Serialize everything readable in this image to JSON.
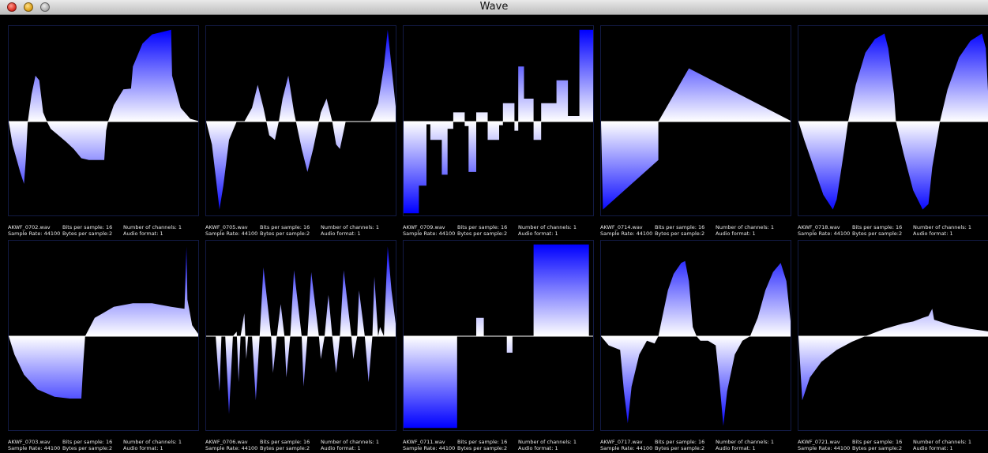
{
  "window": {
    "title": "Wave"
  },
  "colors": {
    "wave_fill_edge": "#0000ff",
    "wave_fill_center": "#ffffff",
    "background": "#000000",
    "frame": "#121a44"
  },
  "labels": {
    "bits_per_sample": "Bits per sample: 16",
    "bytes_per_sample": "Bytes per sample:2",
    "channels": "Number of channels: 1",
    "audio_format": "Audio format: 1"
  },
  "panels": [
    {
      "file": "AKWF_0702.wav",
      "sample_rate": "Sample Rate: 44100",
      "samples": [
        [
          0,
          0
        ],
        [
          0.02,
          -0.25
        ],
        [
          0.06,
          -0.55
        ],
        [
          0.08,
          -0.68
        ],
        [
          0.09,
          -0.4
        ],
        [
          0.1,
          0
        ],
        [
          0.12,
          0.3
        ],
        [
          0.14,
          0.5
        ],
        [
          0.16,
          0.45
        ],
        [
          0.18,
          0.1
        ],
        [
          0.2,
          0
        ],
        [
          0.22,
          -0.08
        ],
        [
          0.26,
          -0.15
        ],
        [
          0.3,
          -0.22
        ],
        [
          0.34,
          -0.3
        ],
        [
          0.38,
          -0.4
        ],
        [
          0.42,
          -0.42
        ],
        [
          0.48,
          -0.42
        ],
        [
          0.5,
          -0.42
        ],
        [
          0.51,
          -0.1
        ],
        [
          0.52,
          0
        ],
        [
          0.55,
          0.18
        ],
        [
          0.6,
          0.35
        ],
        [
          0.64,
          0.36
        ],
        [
          0.65,
          0.6
        ],
        [
          0.7,
          0.85
        ],
        [
          0.75,
          0.95
        ],
        [
          0.85,
          1
        ],
        [
          0.855,
          0.5
        ],
        [
          0.9,
          0.15
        ],
        [
          0.95,
          0.03
        ],
        [
          1,
          0
        ]
      ]
    },
    {
      "file": "AKWF_0705.wav",
      "sample_rate": "Sample Rate: 44100",
      "samples": [
        [
          0,
          0
        ],
        [
          0.03,
          -0.25
        ],
        [
          0.05,
          -0.6
        ],
        [
          0.07,
          -0.96
        ],
        [
          0.09,
          -0.7
        ],
        [
          0.12,
          -0.2
        ],
        [
          0.16,
          0
        ],
        [
          0.2,
          0
        ],
        [
          0.24,
          0.15
        ],
        [
          0.27,
          0.4
        ],
        [
          0.3,
          0.15
        ],
        [
          0.33,
          -0.15
        ],
        [
          0.36,
          -0.2
        ],
        [
          0.38,
          0
        ],
        [
          0.4,
          0.25
        ],
        [
          0.43,
          0.5
        ],
        [
          0.46,
          0.1
        ],
        [
          0.5,
          -0.3
        ],
        [
          0.53,
          -0.55
        ],
        [
          0.56,
          -0.3
        ],
        [
          0.6,
          0.1
        ],
        [
          0.63,
          0.25
        ],
        [
          0.66,
          0
        ],
        [
          0.68,
          -0.25
        ],
        [
          0.7,
          -0.3
        ],
        [
          0.73,
          0
        ],
        [
          0.76,
          0
        ],
        [
          0.8,
          0
        ],
        [
          0.84,
          0
        ],
        [
          0.86,
          0
        ],
        [
          0.9,
          0.2
        ],
        [
          0.93,
          0.6
        ],
        [
          0.95,
          1
        ],
        [
          0.97,
          0.6
        ],
        [
          1,
          0
        ]
      ]
    },
    {
      "file": "AKWF_0709.wav",
      "sample_rate": "Sample Rate: 44100",
      "samples": [
        [
          0,
          -1
        ],
        [
          0.08,
          -1
        ],
        [
          0.08,
          -0.7
        ],
        [
          0.12,
          -0.7
        ],
        [
          0.12,
          -0.03
        ],
        [
          0.14,
          -0.03
        ],
        [
          0.14,
          -0.2
        ],
        [
          0.2,
          -0.2
        ],
        [
          0.2,
          -0.58
        ],
        [
          0.23,
          -0.58
        ],
        [
          0.23,
          -0.08
        ],
        [
          0.26,
          -0.08
        ],
        [
          0.26,
          0.1
        ],
        [
          0.32,
          0.1
        ],
        [
          0.32,
          -0.05
        ],
        [
          0.34,
          -0.05
        ],
        [
          0.34,
          -0.55
        ],
        [
          0.38,
          -0.55
        ],
        [
          0.38,
          0.1
        ],
        [
          0.44,
          0.1
        ],
        [
          0.44,
          -0.2
        ],
        [
          0.5,
          -0.2
        ],
        [
          0.5,
          -0.04
        ],
        [
          0.52,
          -0.04
        ],
        [
          0.52,
          0.2
        ],
        [
          0.58,
          0.2
        ],
        [
          0.58,
          -0.1
        ],
        [
          0.6,
          -0.1
        ],
        [
          0.6,
          0.6
        ],
        [
          0.63,
          0.6
        ],
        [
          0.63,
          0.25
        ],
        [
          0.68,
          0.25
        ],
        [
          0.68,
          -0.2
        ],
        [
          0.72,
          -0.2
        ],
        [
          0.72,
          0.2
        ],
        [
          0.8,
          0.2
        ],
        [
          0.8,
          0.45
        ],
        [
          0.86,
          0.45
        ],
        [
          0.86,
          0.06
        ],
        [
          0.92,
          0.06
        ],
        [
          0.92,
          1
        ],
        [
          1,
          1
        ]
      ]
    },
    {
      "file": "AKWF_0714.wav",
      "sample_rate": "Sample Rate: 44100",
      "samples": [
        [
          0,
          0
        ],
        [
          0.01,
          -0.96
        ],
        [
          0.3,
          -0.42
        ],
        [
          0.3,
          0
        ],
        [
          0.46,
          0.58
        ],
        [
          1,
          0
        ]
      ]
    },
    {
      "file": "AKWF_0718.wav",
      "sample_rate": "Sample Rate: 44100",
      "samples": [
        [
          0,
          0
        ],
        [
          0.03,
          -0.2
        ],
        [
          0.08,
          -0.5
        ],
        [
          0.13,
          -0.8
        ],
        [
          0.18,
          -0.96
        ],
        [
          0.2,
          -0.85
        ],
        [
          0.24,
          -0.3
        ],
        [
          0.26,
          0
        ],
        [
          0.3,
          0.4
        ],
        [
          0.35,
          0.75
        ],
        [
          0.4,
          0.9
        ],
        [
          0.45,
          0.96
        ],
        [
          0.47,
          0.8
        ],
        [
          0.5,
          0.3
        ],
        [
          0.51,
          0
        ],
        [
          0.55,
          -0.35
        ],
        [
          0.6,
          -0.75
        ],
        [
          0.65,
          -0.96
        ],
        [
          0.68,
          -0.9
        ],
        [
          0.7,
          -0.5
        ],
        [
          0.74,
          0
        ],
        [
          0.78,
          0.35
        ],
        [
          0.84,
          0.7
        ],
        [
          0.9,
          0.88
        ],
        [
          0.96,
          0.96
        ],
        [
          0.98,
          0.8
        ],
        [
          1,
          0
        ]
      ]
    },
    {
      "file": "AKWF_0703.wav",
      "sample_rate": "Sample Rate: 44100",
      "samples": [
        [
          0,
          0
        ],
        [
          0.03,
          -0.2
        ],
        [
          0.08,
          -0.42
        ],
        [
          0.15,
          -0.58
        ],
        [
          0.24,
          -0.66
        ],
        [
          0.32,
          -0.68
        ],
        [
          0.38,
          -0.68
        ],
        [
          0.39,
          -0.3
        ],
        [
          0.4,
          0
        ],
        [
          0.45,
          0.2
        ],
        [
          0.55,
          0.32
        ],
        [
          0.65,
          0.36
        ],
        [
          0.75,
          0.36
        ],
        [
          0.85,
          0.32
        ],
        [
          0.92,
          0.3
        ],
        [
          0.93,
          0.98
        ],
        [
          0.935,
          0.4
        ],
        [
          0.96,
          0.12
        ],
        [
          1,
          0
        ]
      ]
    },
    {
      "file": "AKWF_0706.wav",
      "sample_rate": "Sample Rate: 44100",
      "samples": [
        [
          0,
          0
        ],
        [
          0.05,
          0
        ],
        [
          0.07,
          -0.6
        ],
        [
          0.08,
          0
        ],
        [
          0.1,
          0
        ],
        [
          0.12,
          -0.85
        ],
        [
          0.14,
          0
        ],
        [
          0.16,
          0.05
        ],
        [
          0.17,
          -0.5
        ],
        [
          0.18,
          0
        ],
        [
          0.2,
          0.25
        ],
        [
          0.21,
          -0.25
        ],
        [
          0.22,
          0
        ],
        [
          0.24,
          0
        ],
        [
          0.26,
          -0.7
        ],
        [
          0.28,
          0
        ],
        [
          0.3,
          0.75
        ],
        [
          0.34,
          0
        ],
        [
          0.35,
          -0.4
        ],
        [
          0.37,
          0
        ],
        [
          0.39,
          0.35
        ],
        [
          0.41,
          0
        ],
        [
          0.42,
          -0.45
        ],
        [
          0.44,
          0
        ],
        [
          0.46,
          0.72
        ],
        [
          0.5,
          0
        ],
        [
          0.51,
          -0.55
        ],
        [
          0.53,
          0
        ],
        [
          0.55,
          0.7
        ],
        [
          0.59,
          0
        ],
        [
          0.6,
          -0.25
        ],
        [
          0.62,
          0
        ],
        [
          0.64,
          0.45
        ],
        [
          0.66,
          0
        ],
        [
          0.68,
          -0.4
        ],
        [
          0.7,
          0
        ],
        [
          0.72,
          0.72
        ],
        [
          0.76,
          0
        ],
        [
          0.77,
          -0.25
        ],
        [
          0.79,
          0
        ],
        [
          0.8,
          0.5
        ],
        [
          0.83,
          0
        ],
        [
          0.85,
          -0.5
        ],
        [
          0.87,
          0
        ],
        [
          0.88,
          0.65
        ],
        [
          0.9,
          0
        ],
        [
          0.91,
          0.1
        ],
        [
          0.93,
          0
        ],
        [
          0.95,
          0.98
        ],
        [
          0.97,
          0.5
        ],
        [
          1,
          0
        ]
      ]
    },
    {
      "file": "AKWF_0711.wav",
      "sample_rate": "Sample Rate: 44100",
      "samples": [
        [
          0,
          -1
        ],
        [
          0.28,
          -1
        ],
        [
          0.28,
          0
        ],
        [
          0.38,
          0
        ],
        [
          0.38,
          0.2
        ],
        [
          0.42,
          0.2
        ],
        [
          0.42,
          0
        ],
        [
          0.54,
          0
        ],
        [
          0.54,
          -0.18
        ],
        [
          0.57,
          -0.18
        ],
        [
          0.57,
          0
        ],
        [
          0.68,
          0
        ],
        [
          0.68,
          1
        ],
        [
          0.97,
          1
        ],
        [
          0.97,
          0
        ],
        [
          1,
          0
        ]
      ]
    },
    {
      "file": "AKWF_0717.wav",
      "sample_rate": "Sample Rate: 44100",
      "samples": [
        [
          0,
          0
        ],
        [
          0.04,
          -0.1
        ],
        [
          0.1,
          -0.15
        ],
        [
          0.12,
          -0.6
        ],
        [
          0.14,
          -0.95
        ],
        [
          0.16,
          -0.55
        ],
        [
          0.2,
          -0.2
        ],
        [
          0.24,
          -0.05
        ],
        [
          0.28,
          -0.08
        ],
        [
          0.3,
          0
        ],
        [
          0.32,
          0.2
        ],
        [
          0.35,
          0.5
        ],
        [
          0.38,
          0.68
        ],
        [
          0.42,
          0.8
        ],
        [
          0.44,
          0.82
        ],
        [
          0.46,
          0.6
        ],
        [
          0.48,
          0.1
        ],
        [
          0.5,
          0
        ],
        [
          0.52,
          -0.05
        ],
        [
          0.56,
          -0.05
        ],
        [
          0.6,
          -0.1
        ],
        [
          0.62,
          -0.5
        ],
        [
          0.64,
          -0.98
        ],
        [
          0.66,
          -0.6
        ],
        [
          0.7,
          -0.2
        ],
        [
          0.74,
          -0.05
        ],
        [
          0.78,
          0
        ],
        [
          0.82,
          0.2
        ],
        [
          0.86,
          0.5
        ],
        [
          0.9,
          0.7
        ],
        [
          0.94,
          0.8
        ],
        [
          0.97,
          0.6
        ],
        [
          1,
          0
        ]
      ]
    },
    {
      "file": "AKWF_0721.wav",
      "sample_rate": "Sample Rate: 44100",
      "samples": [
        [
          0,
          0
        ],
        [
          0.02,
          -0.7
        ],
        [
          0.06,
          -0.45
        ],
        [
          0.12,
          -0.28
        ],
        [
          0.2,
          -0.15
        ],
        [
          0.28,
          -0.06
        ],
        [
          0.35,
          0
        ],
        [
          0.45,
          0.08
        ],
        [
          0.55,
          0.14
        ],
        [
          0.6,
          0.16
        ],
        [
          0.65,
          0.2
        ],
        [
          0.68,
          0.22
        ],
        [
          0.7,
          0.3
        ],
        [
          0.71,
          0.18
        ],
        [
          0.8,
          0.12
        ],
        [
          0.9,
          0.08
        ],
        [
          1,
          0.05
        ]
      ]
    }
  ]
}
